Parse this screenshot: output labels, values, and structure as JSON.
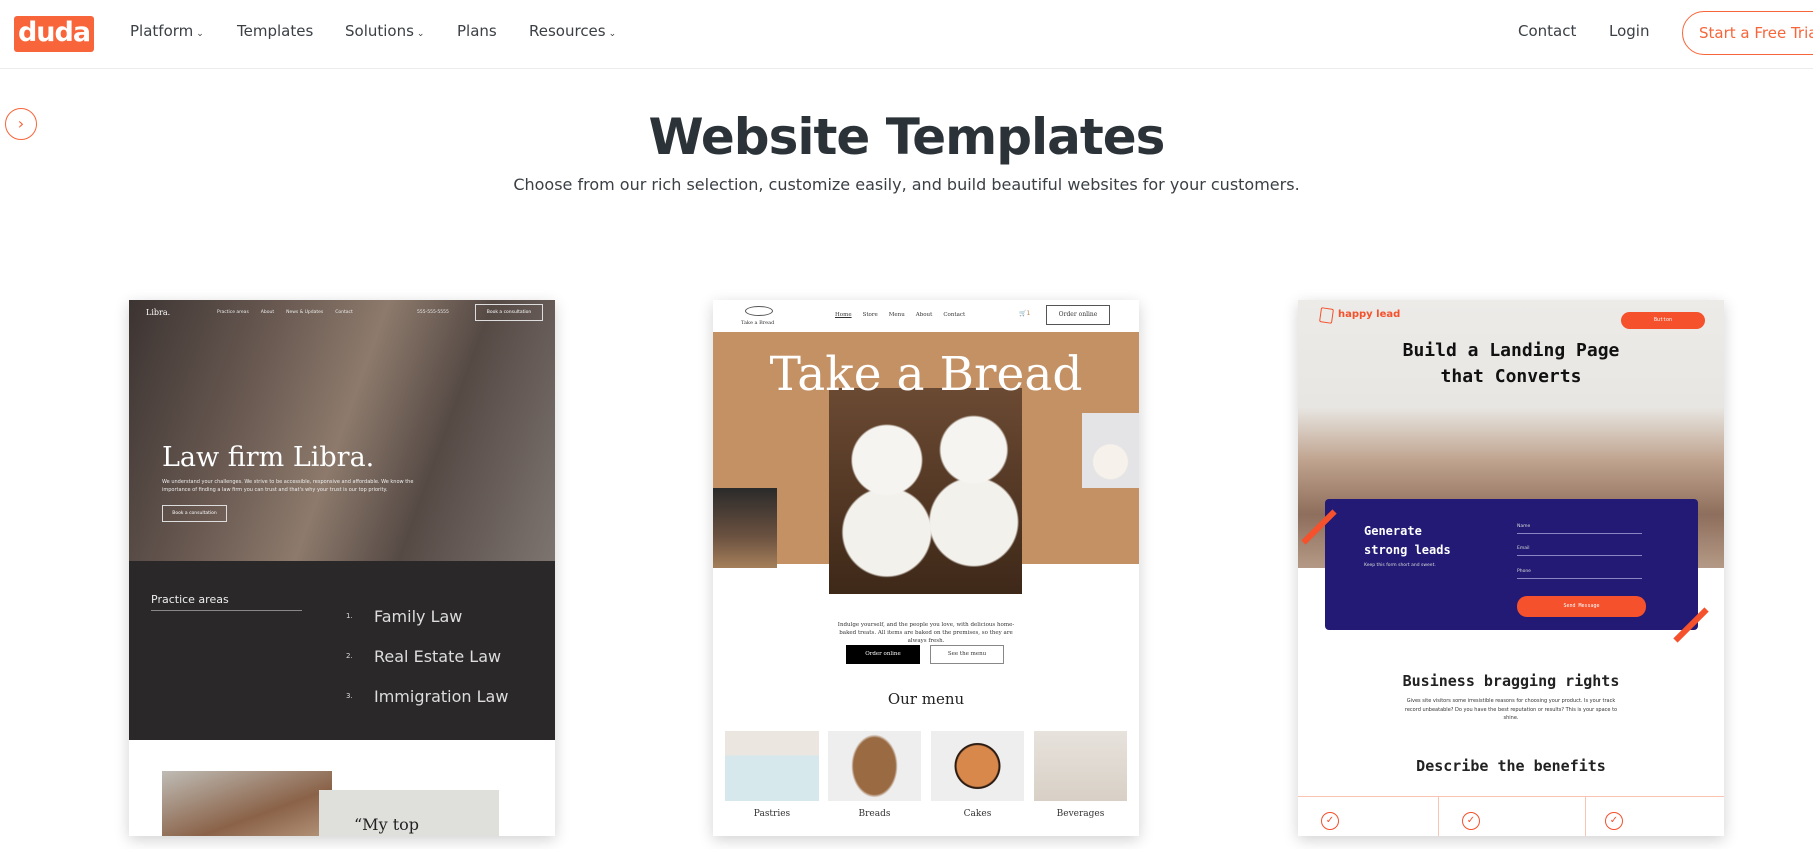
{
  "header": {
    "logo": "duda",
    "nav": [
      {
        "label": "Platform",
        "dropdown": true
      },
      {
        "label": "Templates",
        "dropdown": false
      },
      {
        "label": "Solutions",
        "dropdown": true
      },
      {
        "label": "Plans",
        "dropdown": false
      },
      {
        "label": "Resources",
        "dropdown": true
      }
    ],
    "contact": "Contact",
    "login": "Login",
    "trial": "Start a Free Trial"
  },
  "colors": {
    "brand": "#f8653a",
    "text": "#2c3338"
  },
  "page": {
    "title": "Website Templates",
    "subtitle": "Choose from our rich selection, customize easily, and build beautiful websites for your customers."
  },
  "cards": {
    "libra": {
      "brand": "Libra.",
      "nav": [
        "Practice areas",
        "About",
        "News & Updates",
        "Contact"
      ],
      "phone": "555-555-5555",
      "cta": "Book a consultation",
      "headline": "Law firm Libra.",
      "body": "We understand your challenges. We strive to be accessible, responsive and affordable. We know the importance of finding a law firm you can trust and that's why your trust is our top priority.",
      "cta2": "Book a consultation",
      "section": "Practice areas",
      "areas": [
        {
          "n": "1.",
          "label": "Family Law"
        },
        {
          "n": "2.",
          "label": "Real Estate Law"
        },
        {
          "n": "3.",
          "label": "Immigration Law"
        }
      ],
      "quote": "“My top"
    },
    "bread": {
      "brand": "Take a Bread",
      "nav": [
        "Home",
        "Store",
        "Menu",
        "About",
        "Contact"
      ],
      "cart": "1",
      "order": "Order online",
      "headline": "Take a Bread",
      "body": "Indulge yourself, and the people you love, with delicious home-baked treats. All items are baked on the premises, so they are always fresh.",
      "btn1": "Order online",
      "btn2": "See the menu",
      "menu_title": "Our menu",
      "menu": [
        "Pastries",
        "Breads",
        "Cakes",
        "Beverages"
      ]
    },
    "lead": {
      "brand": "happy lead",
      "button": "Button",
      "headline1": "Build a Landing Page",
      "headline2": "that Converts",
      "form_title1": "Generate",
      "form_title2": "strong leads",
      "form_sub": "Keep this form short and sweet.",
      "fields": [
        "Name",
        "Email",
        "Phone"
      ],
      "send": "Send Message",
      "h2": "Business bragging rights",
      "para": "Gives site visitors some irresistible reasons for choosing your product. Is your track record unbeatable? Do you have the best reputation or results? This is your space to shine.",
      "h3": "Describe the benefits"
    }
  }
}
